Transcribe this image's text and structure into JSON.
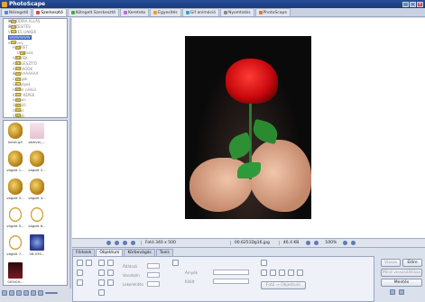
{
  "app": {
    "title": "PhotoScape"
  },
  "tabs": [
    {
      "label": "Nézegető",
      "color": "#5a86d6",
      "active": false
    },
    {
      "label": "Szerkesztő",
      "color": "#d05050",
      "active": true
    },
    {
      "label": "Kötegelt Szerkesztő",
      "color": "#4aa84a",
      "active": false
    },
    {
      "label": "Kereteto",
      "color": "#c06ad6",
      "active": false
    },
    {
      "label": "Egyesítés",
      "color": "#e0a030",
      "active": false
    },
    {
      "label": "Gif animáció",
      "color": "#3aa0c8",
      "active": false
    },
    {
      "label": "Nyomtatás",
      "color": "#8a8a8a",
      "active": false
    },
    {
      "label": "PhotoScape",
      "color": "#e07a30",
      "active": false
    }
  ],
  "tree": [
    {
      "label": "MENÜDÍRA ÁLLÁS",
      "indent": 1,
      "exp": "+",
      "selected": false
    },
    {
      "label": "ÖSSZESITÉS",
      "indent": 1,
      "exp": "+",
      "selected": false
    },
    {
      "label": "VEGYES LINKEK",
      "indent": 1,
      "exp": "",
      "selected": false
    },
    {
      "label": "WWWWWW",
      "indent": 1,
      "exp": "+",
      "selected": true
    },
    {
      "label": "vvvvvvv",
      "indent": 1,
      "exp": "-",
      "selected": false
    },
    {
      "label": "A KERET",
      "indent": 2,
      "exp": "-",
      "selected": false
    },
    {
      "label": "Originals",
      "indent": 3,
      "exp": "",
      "selected": false
    },
    {
      "label": "A KÉPEK",
      "indent": 2,
      "exp": "",
      "selected": false
    },
    {
      "label": "A KEGÉSZÍTŐ",
      "indent": 2,
      "exp": "",
      "selected": false
    },
    {
      "label": "A VIRÁGOK",
      "indent": 2,
      "exp": "",
      "selected": false
    },
    {
      "label": "AAAAAAAAAA",
      "indent": 2,
      "exp": "+",
      "selected": false
    },
    {
      "label": "callagok",
      "indent": 2,
      "exp": "",
      "selected": false
    },
    {
      "label": "GIF képek",
      "indent": 2,
      "exp": "",
      "selected": false
    },
    {
      "label": "Háttér nélkül",
      "indent": 2,
      "exp": "",
      "selected": false
    },
    {
      "label": "KÉSZ KÉPEK",
      "indent": 2,
      "exp": "",
      "selected": false
    },
    {
      "label": "oooooo",
      "indent": 2,
      "exp": "",
      "selected": false
    },
    {
      "label": "öööööö",
      "indent": 2,
      "exp": "",
      "selected": false
    },
    {
      "label": "tamás",
      "indent": 2,
      "exp": "",
      "selected": false
    },
    {
      "label": "Videók",
      "indent": 2,
      "exp": "",
      "selected": false
    }
  ],
  "thumbs": [
    {
      "label": "keret.gif",
      "style": "gold"
    },
    {
      "label": "oklevel_...",
      "style": "pink"
    },
    {
      "label": "vágott 1...",
      "style": "gold"
    },
    {
      "label": "vágott 2...",
      "style": "gold"
    },
    {
      "label": "vágott 3...",
      "style": "gold"
    },
    {
      "label": "vágott 4...",
      "style": "gold"
    },
    {
      "label": "vágott 5...",
      "style": "oval"
    },
    {
      "label": "vágott 6...",
      "style": "oval"
    },
    {
      "label": "vágott 7...",
      "style": "oval"
    },
    {
      "label": "08.039...",
      "style": "blue"
    },
    {
      "label": "005r09...",
      "style": "dark"
    }
  ],
  "status": {
    "photo_size": "Fotó 340 x 500",
    "filename": "00.6251Dg16.jpg",
    "filesize": "46.4 KB",
    "zoom": "100%"
  },
  "tool_tabs": [
    {
      "label": "Fődalok",
      "active": false
    },
    {
      "label": "Objektum",
      "active": true
    },
    {
      "label": "Körbevágás",
      "active": false
    },
    {
      "label": "Tools",
      "active": false
    }
  ],
  "tool_labels": {
    "atlatszo": "Átlátszó",
    "vonalszin": "Vonalszín",
    "vonalvastagsag": "Lekerekítés",
    "arnyek": "Árnyék",
    "kitoltes": "Kitölt",
    "foto_objektum": "Fotó → Objektum"
  },
  "side_buttons": {
    "undo": "Vissza",
    "redo": "Előre",
    "undo_all": "Mind visszaállítása",
    "save": "Mentés"
  }
}
